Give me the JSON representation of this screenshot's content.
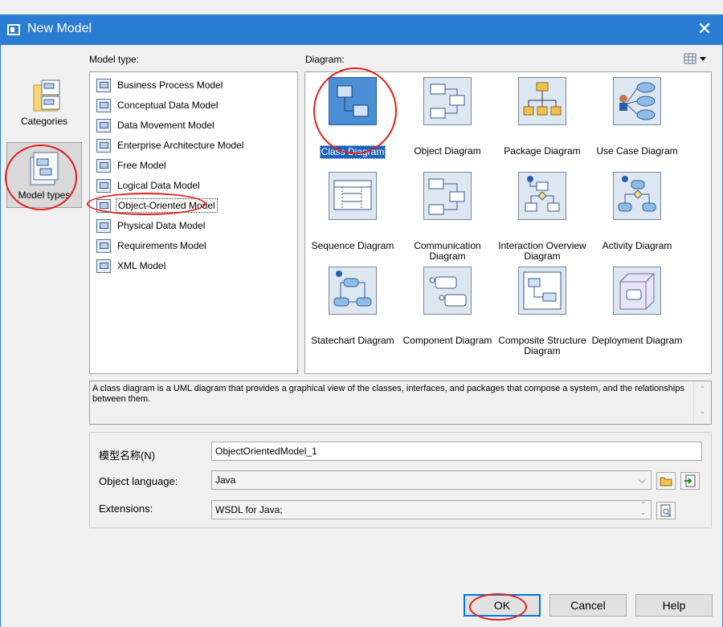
{
  "window": {
    "title": "New Model"
  },
  "categories": [
    {
      "label": "Categories",
      "selected": false
    },
    {
      "label": "Model types",
      "selected": true
    }
  ],
  "model_type_label": "Model type:",
  "diagram_label": "Diagram:",
  "model_types": [
    {
      "label": "Business Process Model"
    },
    {
      "label": "Conceptual Data Model"
    },
    {
      "label": "Data Movement Model"
    },
    {
      "label": "Enterprise Architecture Model"
    },
    {
      "label": "Free Model"
    },
    {
      "label": "Logical Data Model"
    },
    {
      "label": "Object-Oriented Model",
      "selected": true
    },
    {
      "label": "Physical Data Model"
    },
    {
      "label": "Requirements Model"
    },
    {
      "label": "XML Model"
    }
  ],
  "diagrams": [
    {
      "label": "Class Diagram",
      "selected": true
    },
    {
      "label": "Object Diagram"
    },
    {
      "label": "Package Diagram"
    },
    {
      "label": "Use Case Diagram"
    },
    {
      "label": "Sequence Diagram"
    },
    {
      "label": "Communication Diagram"
    },
    {
      "label": "Interaction Overview Diagram"
    },
    {
      "label": "Activity Diagram"
    },
    {
      "label": "Statechart Diagram"
    },
    {
      "label": "Component Diagram"
    },
    {
      "label": "Composite Structure Diagram"
    },
    {
      "label": "Deployment Diagram"
    }
  ],
  "description": "A class diagram is a UML diagram that provides a graphical view of the classes, interfaces, and packages that compose a system, and the relationships between them.",
  "props": {
    "name_label": "模型名称(N)",
    "name_value": "ObjectOrientedModel_1",
    "language_label": "Object language:",
    "language_value": "Java",
    "extensions_label": "Extensions:",
    "extensions_value": "WSDL for Java;"
  },
  "buttons": {
    "ok": "OK",
    "cancel": "Cancel",
    "help": "Help"
  },
  "icons": {
    "close": "close-icon",
    "view_menu": "grid-view-icon",
    "browse": "folder-icon",
    "import": "import-icon",
    "select_extensions": "select-icon"
  },
  "colors": {
    "titlebar": "#2b7cd3",
    "selection": "#1e63b8",
    "annotation": "#e0201e"
  }
}
